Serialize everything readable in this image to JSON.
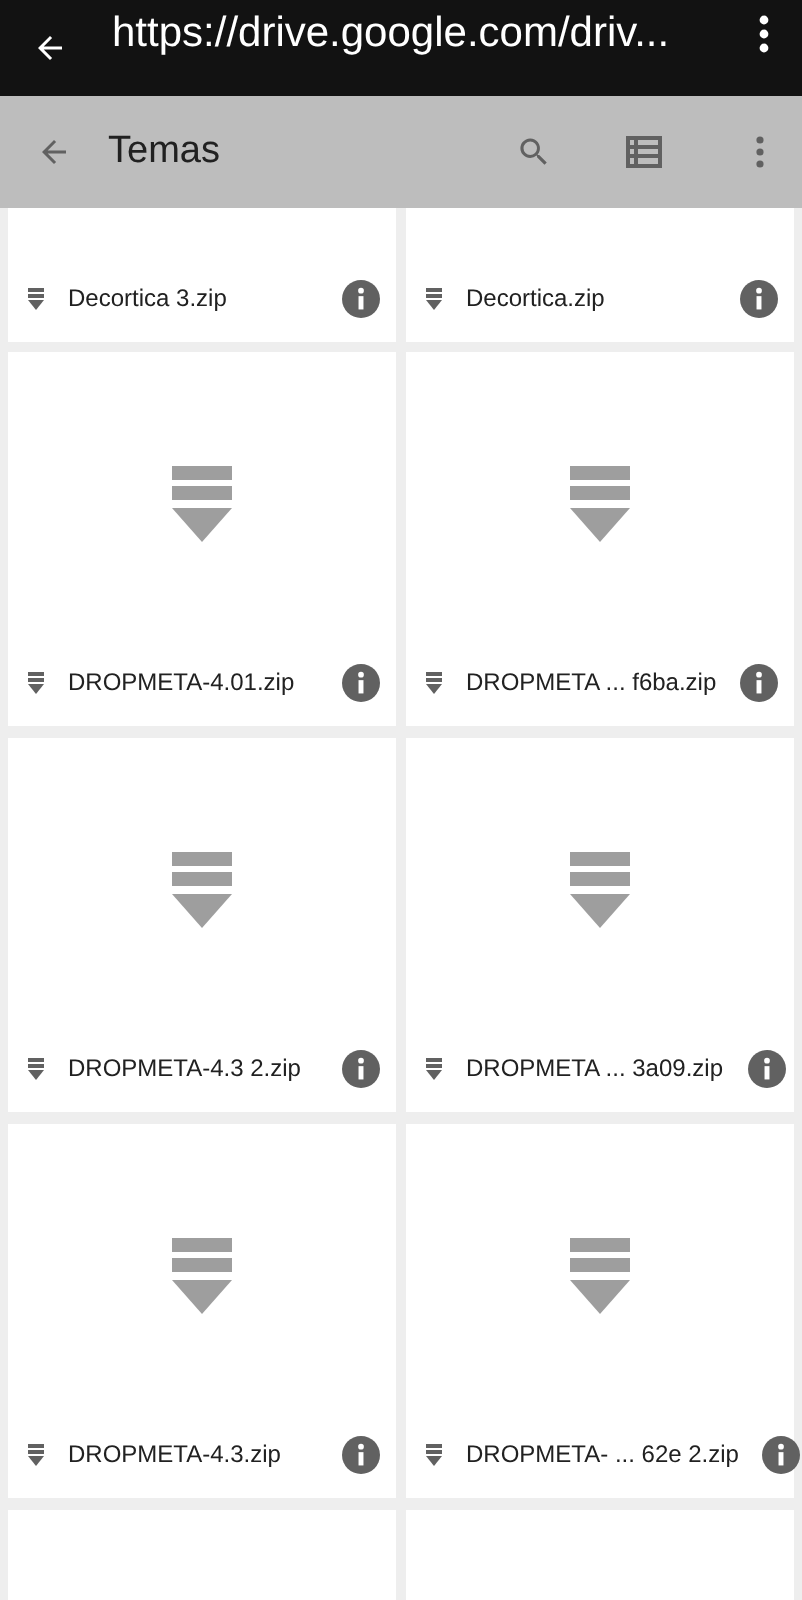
{
  "browser_bar": {
    "url": "https://drive.google.com/driv..."
  },
  "toolbar": {
    "title": "Temas"
  },
  "partial_top_files": [
    {
      "name": "Decortica 3.zip"
    },
    {
      "name": "Decortica.zip"
    }
  ],
  "files": [
    {
      "name": "DROPMETA-4.01.zip"
    },
    {
      "name": "DROPMETA ... f6ba.zip"
    },
    {
      "name": "DROPMETA-4.3 2.zip"
    },
    {
      "name": "DROPMETA ... 3a09.zip"
    },
    {
      "name": "DROPMETA-4.3.zip"
    },
    {
      "name": "DROPMETA- ... 62e 2.zip"
    }
  ]
}
